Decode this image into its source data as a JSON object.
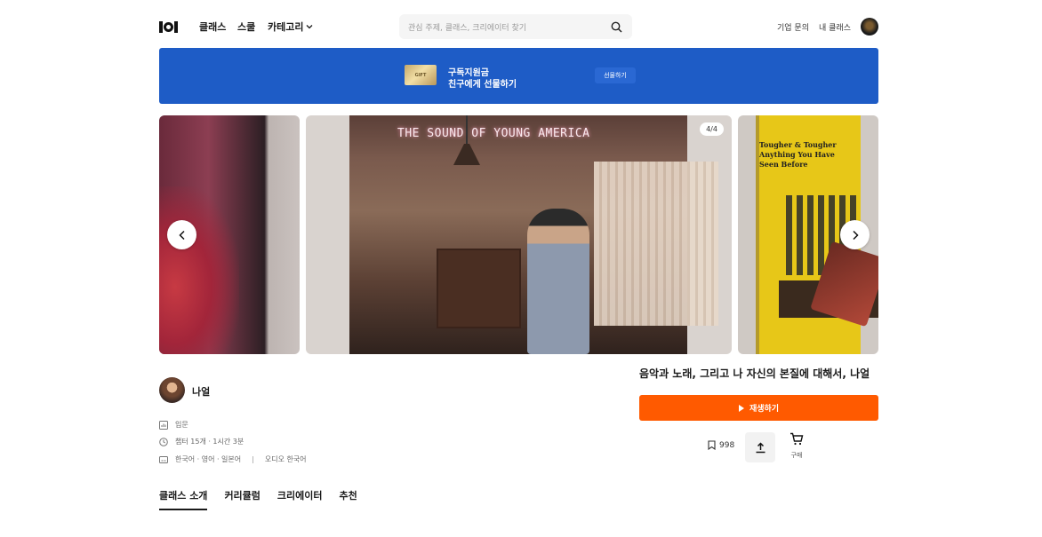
{
  "header": {
    "nav": {
      "classes": "클래스",
      "school": "스쿨",
      "category": "카테고리"
    },
    "search": {
      "placeholder": "관심 주제, 클래스, 크리에이터 찾기"
    },
    "links": {
      "business": "기업 문의",
      "my_classes": "내 클래스"
    }
  },
  "banner": {
    "gift_card_text": "GIFT",
    "line1": "구독지원금",
    "line2": "친구에게 선물하기",
    "button": "선물하기",
    "color": "#1e5cc6"
  },
  "carousel": {
    "counter": "4/4",
    "neon_text": "THE SOUND OF YOUNG AMERICA",
    "poster_text": "Tougher & Tougher Anything You Have Seen Before"
  },
  "creator": {
    "name": "나얼"
  },
  "meta": {
    "level": "입문",
    "duration": "챕터 15개 · 1시간 3분",
    "subtitles": "한국어 · 영어 · 일본어",
    "audio": "오디오 한국어"
  },
  "class": {
    "title": "음악과 노래, 그리고 나 자신의 본질에 대해서, 나얼",
    "play_label": "재생하기",
    "bookmarks": "998",
    "buy_label": "구매",
    "accent_color": "#ff5a00"
  },
  "tabs": [
    {
      "label": "클래스 소개",
      "active": true
    },
    {
      "label": "커리큘럼",
      "active": false
    },
    {
      "label": "크리에이터",
      "active": false
    },
    {
      "label": "추천",
      "active": false
    }
  ]
}
